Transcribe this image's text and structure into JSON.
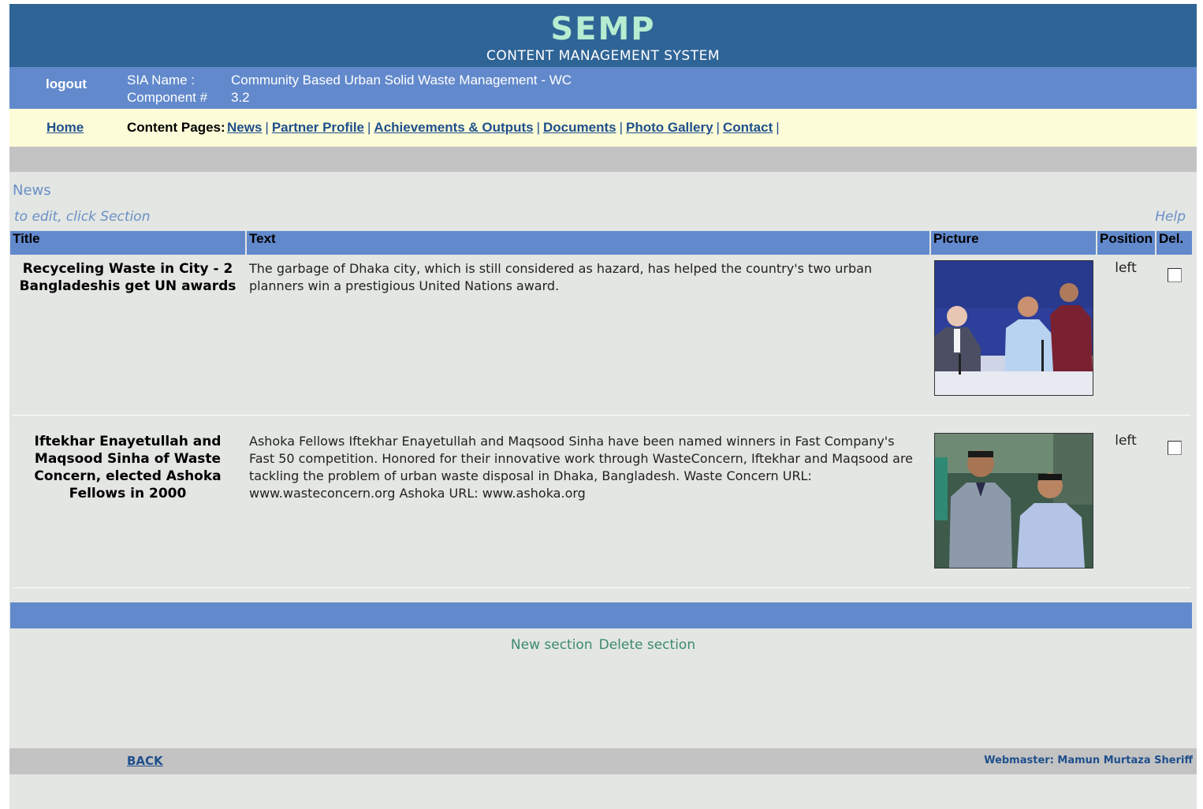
{
  "header": {
    "title": "SEMP",
    "subtitle": "CONTENT MANAGEMENT SYSTEM"
  },
  "info": {
    "logout_label": "logout",
    "sia_label": "SIA Name :",
    "sia_value": "Community Based Urban Solid Waste Management - WC",
    "component_label": "Component #",
    "component_value": "3.2"
  },
  "nav": {
    "home_label": "Home",
    "content_pages_label": "Content Pages:",
    "links": [
      "News",
      "Partner Profile",
      "Achievements & Outputs",
      "Documents",
      "Photo Gallery",
      "Contact"
    ]
  },
  "section": {
    "title": "News",
    "hint": "to edit, click Section",
    "help_label": "Help"
  },
  "table": {
    "columns": [
      "Title",
      "Text",
      "Picture",
      "Position",
      "Del."
    ],
    "rows": [
      {
        "title": "Recyceling Waste in City - 2 Bangladeshis get UN awards",
        "text": "The garbage of Dhaka city, which is still considered as hazard, has helped the country's two urban planners win a prestigious United Nations award.",
        "picture": "photo of three men seated at a conference table",
        "position": "left",
        "delete_checked": false
      },
      {
        "title": "Iftekhar Enayetullah and Maqsood Sinha of Waste Concern, elected Ashoka Fellows in 2000",
        "text": "Ashoka Fellows Iftekhar Enayetullah and Maqsood Sinha have been named winners in Fast Company's Fast 50 competition. Honored for their innovative work through WasteConcern, Iftekhar and Maqsood are tackling the problem of urban waste disposal in Dhaka, Bangladesh. Waste Concern URL: www.wasteconcern.org Ashoka URL: www.ashoka.org",
        "picture": "photo of two men standing side by side",
        "position": "left",
        "delete_checked": false
      }
    ]
  },
  "actions": {
    "new_section": "New section",
    "delete_section": "Delete section"
  },
  "footer": {
    "back_label": "BACK",
    "webmaster": "Webmaster: Mamun Murtaza Sheriff"
  },
  "colors": {
    "header_bg": "#2f6496",
    "info_bg": "#6289cc",
    "nav_bg": "#fcfcd8",
    "page_bg": "#e3e6e2",
    "title_color": "#b6ecd0"
  }
}
